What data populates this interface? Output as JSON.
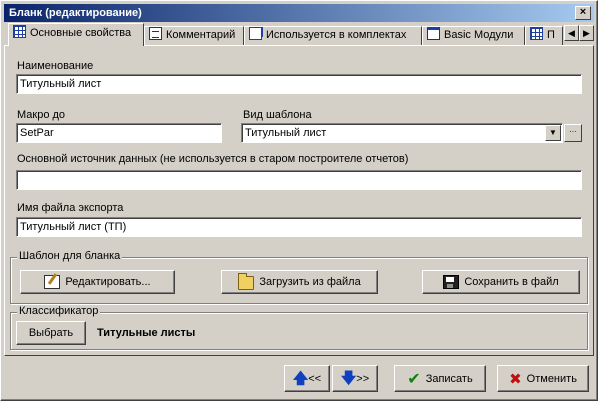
{
  "window": {
    "title": "Бланк (редактирование)",
    "close_glyph": "×"
  },
  "tabs": [
    {
      "label": "Основные свойства",
      "icon": "grid-icon",
      "active": true
    },
    {
      "label": "Комментарий",
      "icon": "document-icon",
      "active": false
    },
    {
      "label": "Используется в комплектах",
      "icon": "set-icon",
      "active": false
    },
    {
      "label": "Basic Модули",
      "icon": "module-icon",
      "active": false
    },
    {
      "label": "П",
      "icon": "table-icon",
      "active": false
    }
  ],
  "tab_scroll": {
    "left": "◀",
    "right": "▶"
  },
  "form": {
    "name_label": "Наименование",
    "name_value": "Титульный лист",
    "macro_label": "Макро до",
    "macro_value": "SetPar",
    "template_label": "Вид шаблона",
    "template_value": "Титульный лист",
    "template_dropdown_glyph": "▼",
    "template_more_glyph": "···",
    "datasource_label": "Основной источник данных (не используется в старом построителе отчетов)",
    "datasource_value": "",
    "export_label": "Имя файла экспорта",
    "export_value": "Титульный лист (ТП)"
  },
  "template_group": {
    "title": "Шаблон для бланка",
    "edit_button": "Редактировать...",
    "load_button": "Загрузить из файла",
    "save_button": "Сохранить в файл"
  },
  "classifier_group": {
    "title": "Классификатор",
    "choose_button": "Выбрать",
    "value": "Титульные листы"
  },
  "footer": {
    "prev_label": "<<",
    "next_label": ">>",
    "up_glyph": "🡅",
    "down_glyph": "🡇",
    "save_label": "Записать",
    "save_glyph": "✔",
    "cancel_label": "Отменить",
    "cancel_glyph": "✖"
  }
}
